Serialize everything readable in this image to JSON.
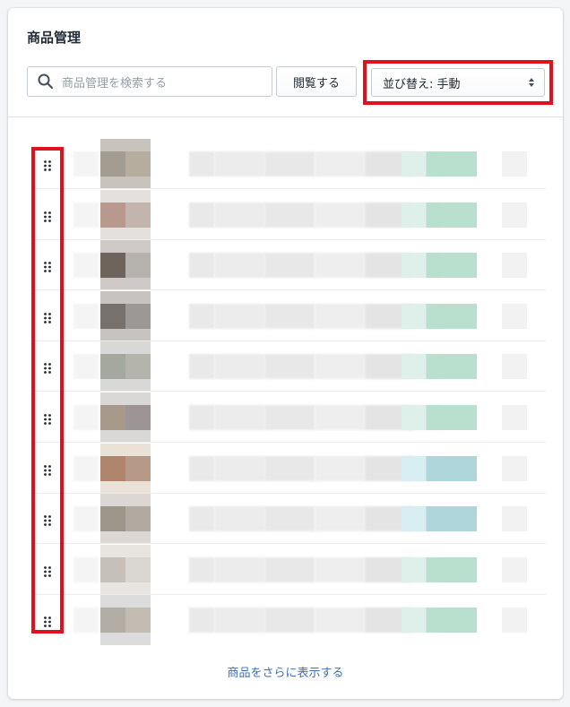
{
  "section": {
    "title": "商品管理"
  },
  "search": {
    "placeholder": "商品管理を検索する",
    "icon": "search-icon"
  },
  "browse_button": {
    "label": "閲覧する"
  },
  "sort": {
    "label": "並び替え: 手動",
    "icon": "select-caret-icon"
  },
  "products": {
    "count_visible": 10,
    "items": [
      {
        "thumb_colors": [
          "#c9c3bd",
          "#a39c91",
          "#b6ad9e"
        ],
        "badge_colors": [
          "#dff0ea",
          "#b9e0cf"
        ]
      },
      {
        "thumb_colors": [
          "#e3e0dd",
          "#b9998d",
          "#c4b4ae"
        ],
        "badge_colors": [
          "#dff0ea",
          "#b9e0cf"
        ]
      },
      {
        "thumb_colors": [
          "#cfcac7",
          "#6f645c",
          "#b6b2ad"
        ],
        "badge_colors": [
          "#dff0ea",
          "#b9e0cf"
        ]
      },
      {
        "thumb_colors": [
          "#c6c3c1",
          "#77716e",
          "#9b9895"
        ],
        "badge_colors": [
          "#dff0ea",
          "#b9e0cf"
        ]
      },
      {
        "thumb_colors": [
          "#d8d8d6",
          "#a4a89f",
          "#b4b4ad"
        ],
        "badge_colors": [
          "#dff0ea",
          "#b9e0cf"
        ]
      },
      {
        "thumb_colors": [
          "#d9d8d6",
          "#a89a8a",
          "#9d9595"
        ],
        "badge_colors": [
          "#dff0ea",
          "#b9e0cf"
        ]
      },
      {
        "thumb_colors": [
          "#ebe2d7",
          "#b0856d",
          "#b69a87"
        ],
        "badge_colors": [
          "#d7edf1",
          "#aed6db"
        ]
      },
      {
        "thumb_colors": [
          "#ddd7d3",
          "#9e958a",
          "#b2aaa0"
        ],
        "badge_colors": [
          "#d7edf1",
          "#aed6db"
        ]
      },
      {
        "thumb_colors": [
          "#e8e4e0",
          "#c7c0b9",
          "#dad6d2"
        ],
        "badge_colors": [
          "#dff0ea",
          "#b9e0cf"
        ]
      },
      {
        "thumb_colors": [
          "#dcdcdc",
          "#b2aea6",
          "#c3bcb2"
        ],
        "badge_colors": [
          "#dff0ea",
          "#b9e0cf"
        ]
      }
    ]
  },
  "show_more": {
    "label": "商品をさらに表示する"
  },
  "colors": {
    "highlight": "#e0101f",
    "link": "#3e6eb6",
    "divider": "#dfe3e8"
  }
}
